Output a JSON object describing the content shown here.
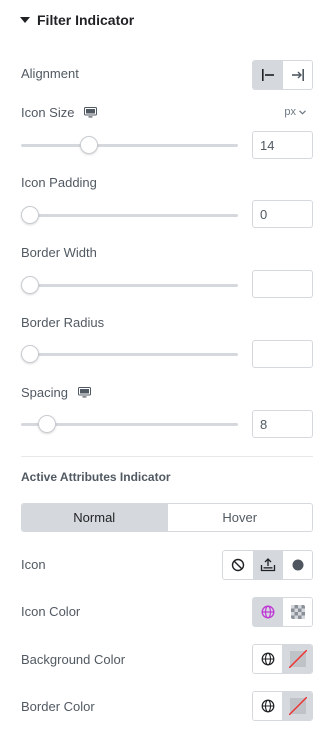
{
  "section": {
    "title": "Filter Indicator"
  },
  "alignment": {
    "label": "Alignment",
    "options": [
      "align-start-icon",
      "align-end-icon"
    ],
    "selected": 0
  },
  "icon_size": {
    "label": "Icon Size",
    "unit": "px",
    "value": "14",
    "slider_fraction": 0.14
  },
  "icon_padding": {
    "label": "Icon Padding",
    "value": "0",
    "slider_fraction": 0.0
  },
  "border_width": {
    "label": "Border Width",
    "value": "",
    "slider_fraction": 0.0
  },
  "border_radius": {
    "label": "Border Radius",
    "value": "",
    "slider_fraction": 0.0
  },
  "spacing": {
    "label": "Spacing",
    "value": "8",
    "slider_fraction": 0.04
  },
  "active_attributes": {
    "title": "Active Attributes Indicator",
    "tabs": [
      "Normal",
      "Hover"
    ],
    "active_tab": 0
  },
  "icon": {
    "label": "Icon",
    "options": [
      "none-icon",
      "upload-icon",
      "circle-icon"
    ],
    "selected": 1
  },
  "icon_color": {
    "label": "Icon Color",
    "global_color": "#c036d8"
  },
  "background_color": {
    "label": "Background Color"
  },
  "border_color": {
    "label": "Border Color"
  },
  "colors": {
    "accent": "#d5d8dc",
    "text": "#515962",
    "title": "#1f2124",
    "dot": "#4f5660"
  }
}
